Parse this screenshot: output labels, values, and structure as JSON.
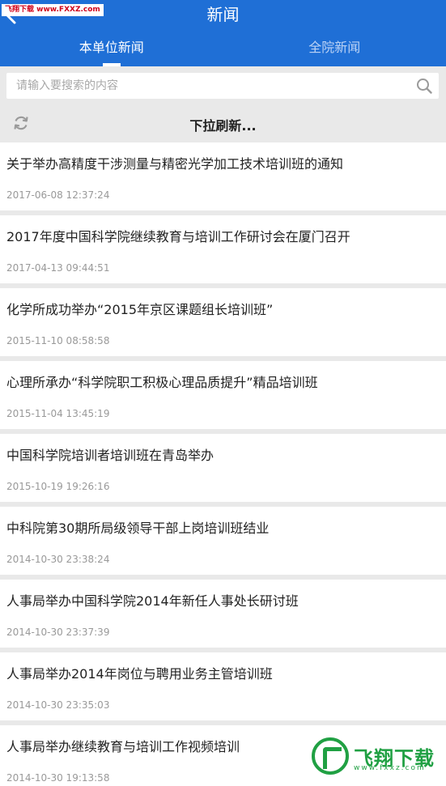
{
  "header": {
    "title": "新闻",
    "watermark_top": "飞翔下载 www.FXXZ.com"
  },
  "tabs": [
    {
      "label": "本单位新闻",
      "active": true
    },
    {
      "label": "全院新闻",
      "active": false
    }
  ],
  "search": {
    "placeholder": "请输入要搜索的内容",
    "value": ""
  },
  "refresh": {
    "label": "下拉刷新..."
  },
  "news": [
    {
      "title": "关于举办高精度干涉测量与精密光学加工技术培训班的通知",
      "date": "2017-06-08 12:37:24"
    },
    {
      "title": "2017年度中国科学院继续教育与培训工作研讨会在厦门召开",
      "date": "2017-04-13 09:44:51"
    },
    {
      "title": "化学所成功举办“2015年京区课题组长培训班”",
      "date": "2015-11-10 08:58:58"
    },
    {
      "title": "心理所承办“科学院职工积极心理品质提升”精品培训班",
      "date": "2015-11-04 13:45:19"
    },
    {
      "title": "中国科学院培训者培训班在青岛举办",
      "date": "2015-10-19 19:26:16"
    },
    {
      "title": "中科院第30期所局级领导干部上岗培训班结业",
      "date": "2014-10-30 23:38:24"
    },
    {
      "title": "人事局举办中国科学院2014年新任人事处长研讨班",
      "date": "2014-10-30 23:37:39"
    },
    {
      "title": "人事局举办2014年岗位与聘用业务主管培训班",
      "date": "2014-10-30 23:35:03"
    },
    {
      "title": "人事局举办继续教育与培训工作视频培训",
      "date": "2014-10-30 19:13:58"
    }
  ],
  "watermark_logo": {
    "text": "飞翔下载",
    "sub": "www.fxxz.com"
  },
  "colors": {
    "header_bg": "#1f6fd6",
    "page_bg": "#e9e9e9",
    "watermark_green": "#20a043"
  },
  "icons": [
    "back-arrow-icon",
    "search-icon",
    "refresh-icon"
  ]
}
